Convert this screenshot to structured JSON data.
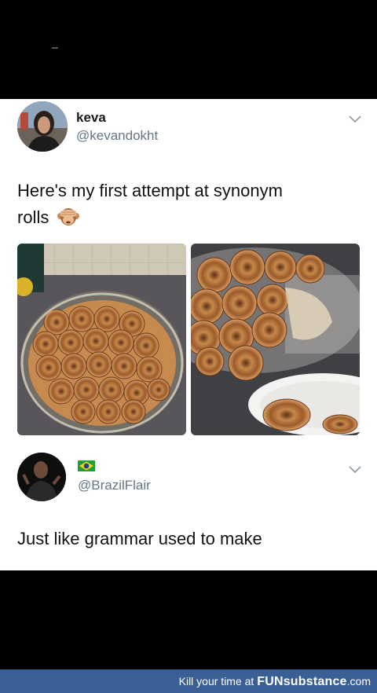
{
  "tweet1": {
    "name": "keva",
    "handle": "@kevandokht",
    "text_line1": "Here's my first attempt at synonym",
    "text_line2": "rolls",
    "emoji": "see-no-evil-monkey-icon"
  },
  "tweet2": {
    "handle": "@BrazilFlair",
    "text": "Just like grammar used to make",
    "flag": "brazil-flag-icon"
  },
  "footer": {
    "prefix": "Kill your time at",
    "brand_bold": "FUN",
    "brand_rest": "substance",
    "suffix": ".com"
  },
  "colors": {
    "handle": "#657786",
    "footer_bg": "#3a5f94"
  }
}
